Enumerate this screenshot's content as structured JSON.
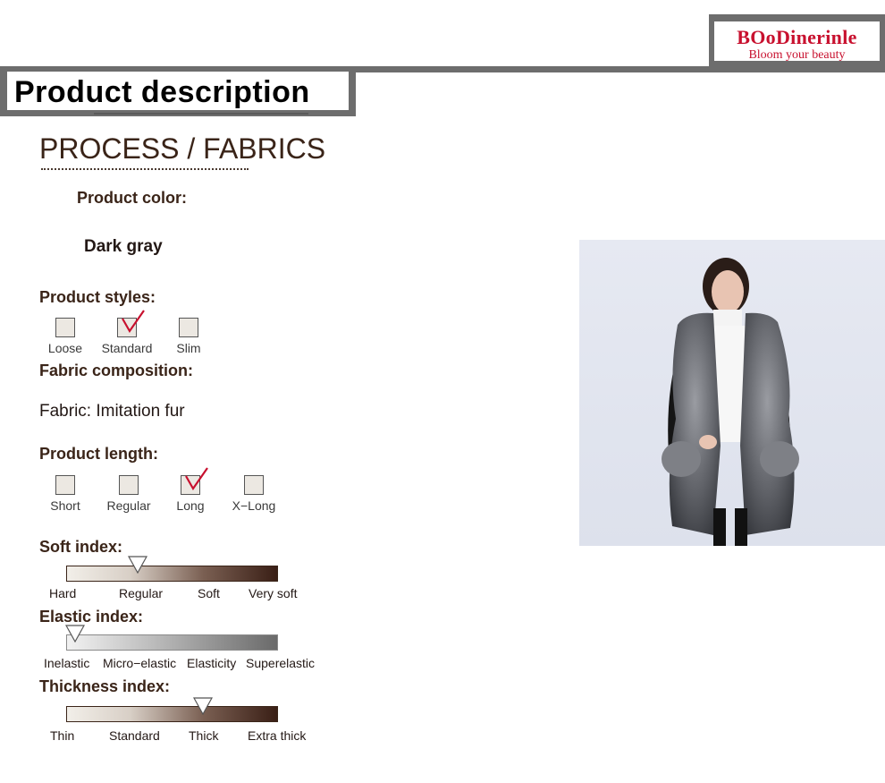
{
  "brand": {
    "name": "BOoDinerinle",
    "tagline": "Bloom your beauty",
    "color": "#c8102e"
  },
  "header": {
    "title": "Product description"
  },
  "section": {
    "title": "PROCESS / FABRICS"
  },
  "color": {
    "label": "Product color:",
    "value": "Dark gray"
  },
  "styles": {
    "label": "Product styles:",
    "options": [
      {
        "label": "Loose",
        "checked": false
      },
      {
        "label": "Standard",
        "checked": true
      },
      {
        "label": "Slim",
        "checked": false
      }
    ]
  },
  "fabric": {
    "label": "Fabric composition:",
    "value": "Fabric: Imitation fur"
  },
  "length": {
    "label": "Product length:",
    "options": [
      {
        "label": "Short",
        "checked": false
      },
      {
        "label": "Regular",
        "checked": false
      },
      {
        "label": "Long",
        "checked": true
      },
      {
        "label": "X−Long",
        "checked": false
      }
    ]
  },
  "soft": {
    "label": "Soft index:",
    "scale": [
      "Hard",
      "Regular",
      "Soft",
      "Very soft"
    ],
    "selected_index": 1
  },
  "elastic": {
    "label": "Elastic index:",
    "scale": [
      "Inelastic",
      "Micro−elastic",
      "Elasticity",
      "Superelastic"
    ],
    "selected_index": 0
  },
  "thickness": {
    "label": "Thickness index:",
    "scale": [
      "Thin",
      "Standard",
      "Thick",
      "Extra thick"
    ],
    "selected_index": 2
  },
  "colors": {
    "frame_gray": "#6d6d6d",
    "text_brown": "#3a2418",
    "check_red": "#c8102e"
  }
}
